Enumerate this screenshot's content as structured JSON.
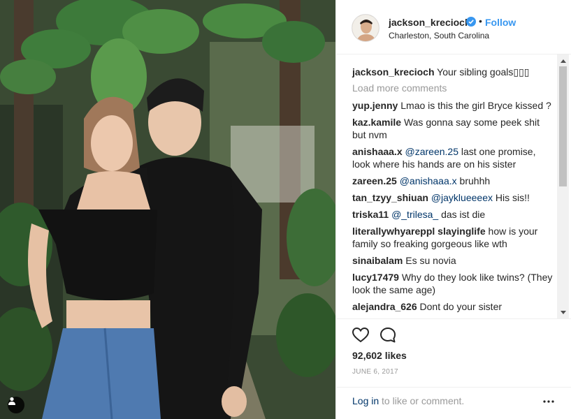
{
  "header": {
    "username": "jackson_krecioch",
    "separator": "•",
    "follow_label": "Follow",
    "location": "Charleston, South Carolina"
  },
  "caption": {
    "user": "jackson_krecioch",
    "text": "Your sibling goals▯▯▯"
  },
  "load_more_label": "Load more comments",
  "comments": [
    {
      "user": "yup.jenny",
      "mention": "",
      "text": "Lmao is this the girl Bryce kissed ?"
    },
    {
      "user": "kaz.kamile",
      "mention": "",
      "text": "Was gonna say some peek shit but nvm"
    },
    {
      "user": "anishaaa.x",
      "mention": "@zareen.25",
      "text": "last one promise, look where his hands are on his sister"
    },
    {
      "user": "zareen.25",
      "mention": "@anishaaa.x",
      "text": "bruhhh"
    },
    {
      "user": "tan_tzyy_shiuan",
      "mention": "@jayklueeeex",
      "text": "His sis!!"
    },
    {
      "user": "triska11",
      "mention": "@_trilesa_",
      "text": "das ist die"
    },
    {
      "user": "literallywhyareppl slayinglife",
      "mention": "",
      "text": "how is your family so freaking gorgeous like wth"
    },
    {
      "user": "sinaibalam",
      "mention": "",
      "text": "Es su novia"
    },
    {
      "user": "lucy17479",
      "mention": "",
      "text": "Why do they look like twins? (They look the same age)"
    },
    {
      "user": "alejandra_626",
      "mention": "",
      "text": "Dont do your sister"
    }
  ],
  "likes_count": "92,602 likes",
  "date": "JUNE 6, 2017",
  "login_prompt": {
    "link": "Log in",
    "text": " to like or comment."
  },
  "more_label": "•••",
  "icons": {
    "like": "heart-icon",
    "comment": "comment-bubble-icon",
    "verified": "verified-badge-icon",
    "tag": "user-tag-icon",
    "more": "more-options-icon"
  },
  "colors": {
    "accent": "#3897f0",
    "username_link": "#003569",
    "muted": "#999999",
    "text": "#262626"
  }
}
